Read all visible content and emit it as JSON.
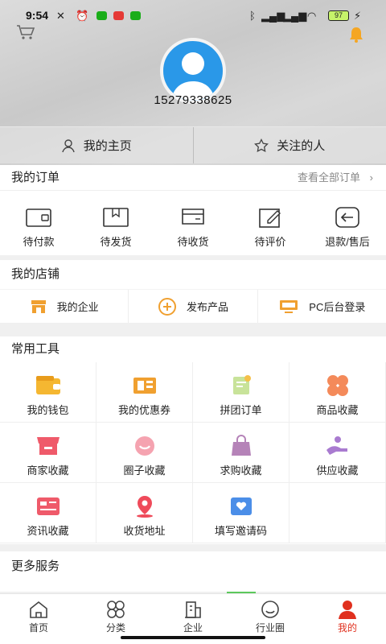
{
  "status_bar": {
    "time": "9:54",
    "battery": "97"
  },
  "profile": {
    "phone": "15279338625"
  },
  "profile_tabs": [
    {
      "label": "我的主页",
      "icon": "person-icon"
    },
    {
      "label": "关注的人",
      "icon": "star-icon"
    }
  ],
  "orders": {
    "title": "我的订单",
    "more_label": "查看全部订单",
    "items": [
      {
        "label": "待付款",
        "icon": "wallet-icon"
      },
      {
        "label": "待发货",
        "icon": "box-icon"
      },
      {
        "label": "待收货",
        "icon": "card-icon"
      },
      {
        "label": "待评价",
        "icon": "edit-icon"
      },
      {
        "label": "退款/售后",
        "icon": "return-icon"
      }
    ]
  },
  "shop": {
    "title": "我的店铺",
    "items": [
      {
        "label": "我的企业",
        "icon": "store-icon"
      },
      {
        "label": "发布产品",
        "icon": "plus-circle-icon"
      },
      {
        "label": "PC后台登录",
        "icon": "monitor-icon"
      }
    ]
  },
  "tools": {
    "title": "常用工具",
    "items": [
      {
        "label": "我的钱包",
        "icon": "wallet-icon"
      },
      {
        "label": "我的优惠券",
        "icon": "coupon-icon"
      },
      {
        "label": "拼团订单",
        "icon": "group-order-icon"
      },
      {
        "label": "商品收藏",
        "icon": "clover-icon"
      },
      {
        "label": "商家收藏",
        "icon": "shop-awning-icon"
      },
      {
        "label": "圈子收藏",
        "icon": "smile-icon"
      },
      {
        "label": "求购收藏",
        "icon": "bag-icon"
      },
      {
        "label": "供应收藏",
        "icon": "hand-icon"
      },
      {
        "label": "资讯收藏",
        "icon": "news-card-icon"
      },
      {
        "label": "收货地址",
        "icon": "location-pin-icon"
      },
      {
        "label": "填写邀请码",
        "icon": "invite-envelope-icon"
      }
    ]
  },
  "more_services": {
    "title": "更多服务"
  },
  "tabbar": [
    {
      "label": "首页",
      "icon": "home-icon"
    },
    {
      "label": "分类",
      "icon": "category-icon"
    },
    {
      "label": "企业",
      "icon": "building-icon"
    },
    {
      "label": "行业圈",
      "icon": "circle-icon"
    },
    {
      "label": "我的",
      "icon": "user-icon",
      "active": true
    }
  ],
  "colors": {
    "accent_red": "#e0301e",
    "avatar_blue": "#2a98e8",
    "icon_orange": "#f0a030"
  }
}
